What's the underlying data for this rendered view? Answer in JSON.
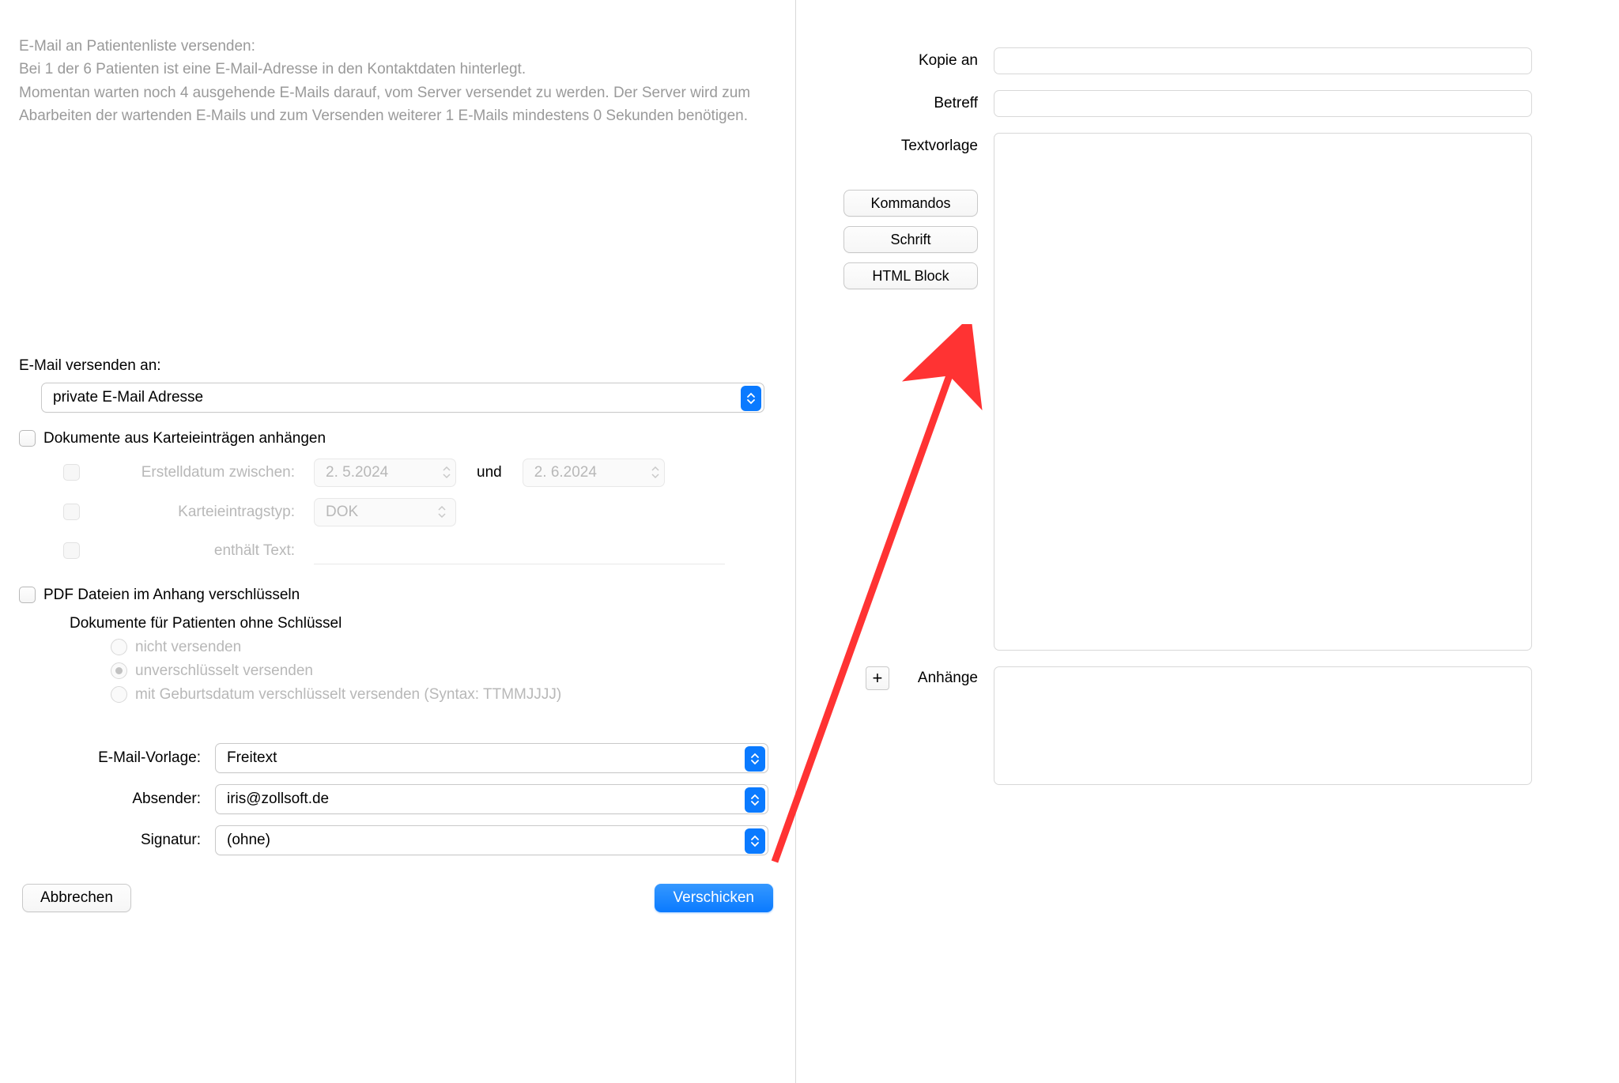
{
  "info": {
    "title": "E-Mail an Patientenliste versenden:",
    "line1": "Bei 1 der 6 Patienten ist eine E-Mail-Adresse in den Kontaktdaten hinterlegt.",
    "line2": "Momentan warten noch 4 ausgehende E-Mails darauf, vom Server versendet zu werden. Der Server wird zum Abarbeiten der wartenden E-Mails und zum Versenden weiterer 1 E-Mails mindestens 0 Sekunden benötigen."
  },
  "send_to": {
    "label": "E-Mail versenden an:",
    "value": "private E-Mail Adresse"
  },
  "attach_docs": {
    "checkbox_label": "Dokumente aus Karteieinträgen anhängen",
    "date_between_label": "Erstelldatum zwischen:",
    "date_from": "2.  5.2024",
    "und": "und",
    "date_to": "2.  6.2024",
    "type_label": "Karteieintragstyp:",
    "type_value": "DOK",
    "contains_label": "enthält Text:"
  },
  "encrypt": {
    "checkbox_label": "PDF Dateien im Anhang verschlüsseln",
    "sub_label": "Dokumente für Patienten ohne Schlüssel",
    "radio1": "nicht versenden",
    "radio2": "unverschlüsselt versenden",
    "radio3": "mit Geburtsdatum verschlüsselt versenden (Syntax: TTMMJJJJ)"
  },
  "template": {
    "label": "E-Mail-Vorlage:",
    "value": "Freitext"
  },
  "sender": {
    "label": "Absender:",
    "value": "iris@zollsoft.de"
  },
  "signature": {
    "label": "Signatur:",
    "value": "(ohne)"
  },
  "buttons": {
    "cancel": "Abbrechen",
    "send": "Verschicken"
  },
  "right": {
    "cc_label": "Kopie an",
    "subject_label": "Betreff",
    "template_label": "Textvorlage",
    "commands": "Kommandos",
    "font": "Schrift",
    "html_block": "HTML Block",
    "attachments_label": "Anhänge",
    "plus": "+"
  }
}
